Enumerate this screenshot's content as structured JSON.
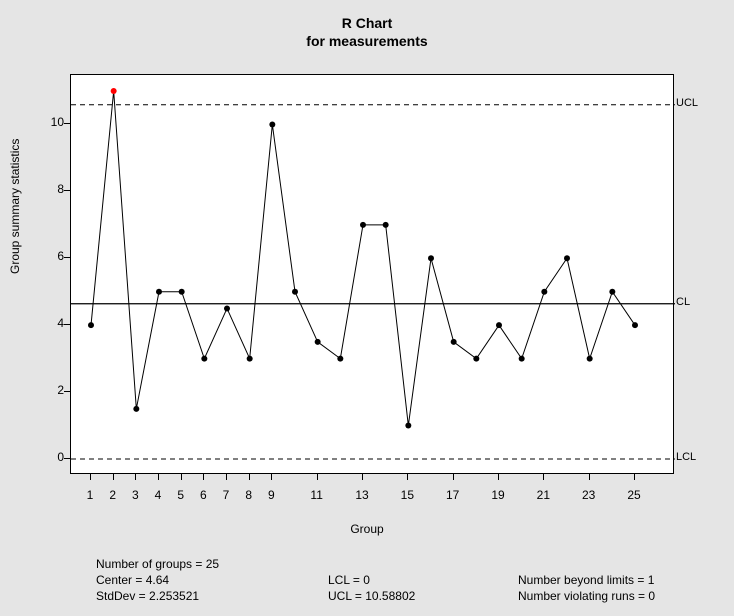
{
  "chart_data": {
    "type": "line",
    "title": "R Chart",
    "subtitle": "for measurements",
    "xlabel": "Group",
    "ylabel": "Group summary statistics",
    "x": [
      1,
      2,
      3,
      4,
      5,
      6,
      7,
      8,
      9,
      10,
      11,
      12,
      13,
      14,
      15,
      16,
      17,
      18,
      19,
      20,
      21,
      22,
      23,
      24,
      25
    ],
    "values": [
      4.0,
      11.0,
      1.5,
      5.0,
      5.0,
      3.0,
      4.5,
      3.0,
      10.0,
      5.0,
      3.5,
      3.0,
      7.0,
      7.0,
      1.0,
      6.0,
      3.5,
      3.0,
      4.0,
      3.0,
      5.0,
      6.0,
      3.0,
      5.0,
      4.0
    ],
    "out_of_control_x": [
      2
    ],
    "xlim": [
      1,
      25
    ],
    "ylim": [
      0,
      11
    ],
    "x_ticks": [
      1,
      2,
      3,
      4,
      5,
      6,
      7,
      8,
      9,
      11,
      13,
      15,
      17,
      19,
      21,
      23,
      25
    ],
    "y_ticks": [
      0,
      2,
      4,
      6,
      8,
      10
    ],
    "control_lines": {
      "UCL": 10.58802,
      "CL": 4.64,
      "LCL": 0
    },
    "limit_labels": {
      "ucl": "UCL",
      "cl": "CL",
      "lcl": "LCL"
    }
  },
  "stats": {
    "num_groups_label": "Number of groups = 25",
    "center_label": "Center = 4.64",
    "stddev_label": "StdDev = 2.253521",
    "lcl_label": "LCL = 0",
    "ucl_label": "UCL = 10.58802",
    "beyond_label": "Number beyond limits = 1",
    "violating_label": "Number violating runs = 0"
  }
}
